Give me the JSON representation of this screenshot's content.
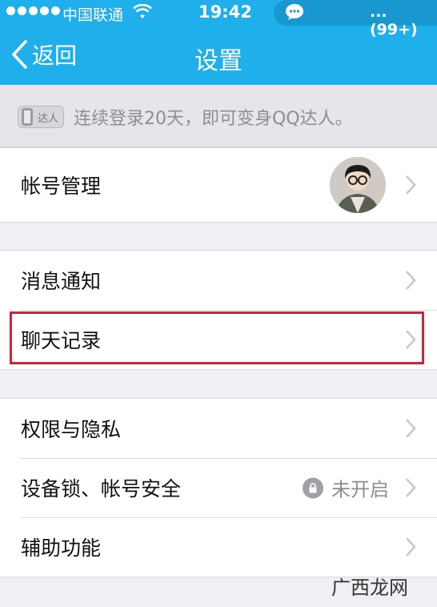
{
  "status_bar": {
    "carrier": "中国联通",
    "time": "19:42",
    "unread": "... (99+)"
  },
  "nav": {
    "back_label": "返回",
    "title": "设置"
  },
  "tip": {
    "badge_label": "达人",
    "text": "连续登录20天，即可变身QQ达人。"
  },
  "groups": [
    {
      "rows": [
        {
          "label": "帐号管理",
          "has_avatar": true
        }
      ]
    },
    {
      "rows": [
        {
          "label": "消息通知"
        },
        {
          "label": "聊天记录",
          "highlighted": true
        }
      ]
    },
    {
      "rows": [
        {
          "label": "权限与隐私"
        },
        {
          "label": "设备锁、帐号安全",
          "value": "未开启",
          "value_icon": "lock-icon"
        },
        {
          "label": "辅助功能"
        }
      ]
    }
  ],
  "watermark": "广西龙网",
  "colors": {
    "header": "#1fb0ec",
    "background": "#efeff4",
    "highlight_border": "#c8293a"
  }
}
